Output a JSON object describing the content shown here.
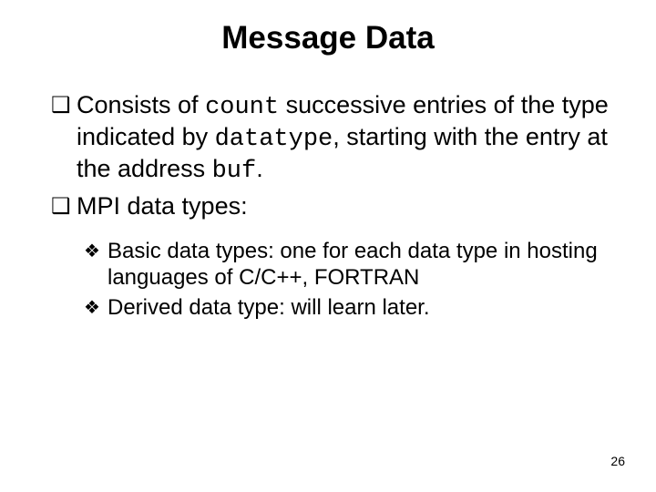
{
  "title": "Message Data",
  "bullets": {
    "b1": {
      "pre": "Consists of ",
      "code1": "count",
      "mid1": " successive entries of the type indicated by ",
      "code2": "datatype",
      "mid2": ", starting with the entry at the address ",
      "code3": "buf",
      "post": "."
    },
    "b2": "MPI data types:",
    "sub": {
      "s1": "Basic data types: one for each data type in hosting languages of C/C++, FORTRAN",
      "s2": "Derived data type: will learn later."
    }
  },
  "page_number": "26"
}
